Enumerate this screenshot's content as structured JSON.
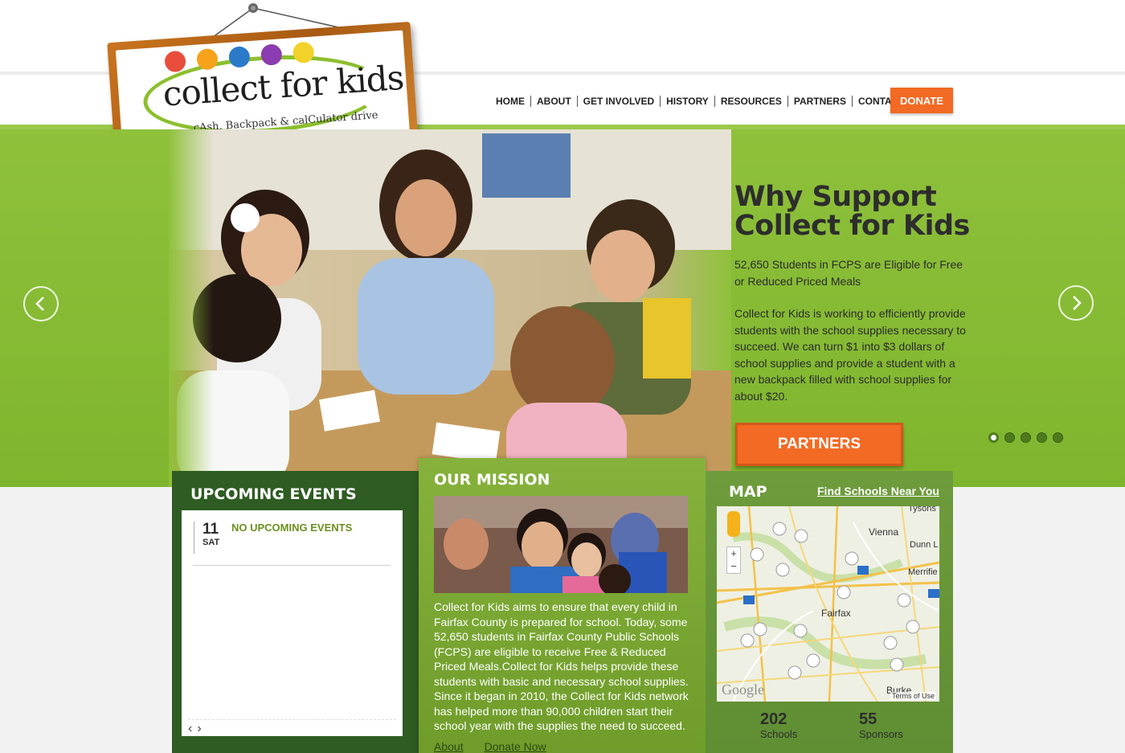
{
  "brand": {
    "logo_title": "collect for kids",
    "logo_tagline": "cAsh, Backpack & calCulator drive",
    "accent_orange": "#f26a23",
    "accent_green": "#8fc13b",
    "dark_green": "#2e5c22"
  },
  "nav": {
    "items": [
      "HOME",
      "ABOUT",
      "GET INVOLVED",
      "HISTORY",
      "RESOURCES",
      "PARTNERS",
      "CONTACTS"
    ],
    "donate_label": "DONATE"
  },
  "hero": {
    "title": "Why Support Collect for Kids",
    "paragraph1": "52,650 Students in FCPS are Eligible for Free or Reduced Priced Meals",
    "paragraph2": "Collect for Kids is working to efficiently provide students with the school supplies necessary to succeed. We can turn $1 into $3 dollars of school supplies and provide a student with a new backpack filled with school supplies for about $20.",
    "cta_label": "PARTNERS",
    "slide_count": 5,
    "active_slide": 1,
    "prev_icon": "chevron-left-icon",
    "next_icon": "chevron-right-icon"
  },
  "events": {
    "title": "UPCOMING EVENTS",
    "day": "11",
    "weekday": "SAT",
    "message": "NO UPCOMING EVENTS",
    "prev_label": "‹",
    "next_label": "›"
  },
  "mission": {
    "title": "OUR MISSION",
    "text": "Collect for Kids aims to ensure that every child in Fairfax County is prepared for school. Today, some 52,650 students in Fairfax County Public Schools (FCPS) are eligible to receive Free & Reduced Priced Meals.Collect for Kids helps provide these students with basic and necessary school supplies. Since it began in 2010, the Collect for Kids network has helped more than 90,000 children start their school year with the supplies the need to succeed.",
    "links": [
      "About",
      "Donate Now"
    ]
  },
  "map": {
    "title": "MAP",
    "link_label": "Find Schools Near You",
    "places": [
      "Vienna",
      "Fairfax",
      "Burke",
      "Merrifie",
      "Dunn L",
      "Tysons"
    ],
    "google_label": "Google",
    "terms_label": "Terms of Use",
    "stats": [
      {
        "number": "202",
        "label": "Schools"
      },
      {
        "number": "55",
        "label": "Sponsors"
      }
    ]
  }
}
